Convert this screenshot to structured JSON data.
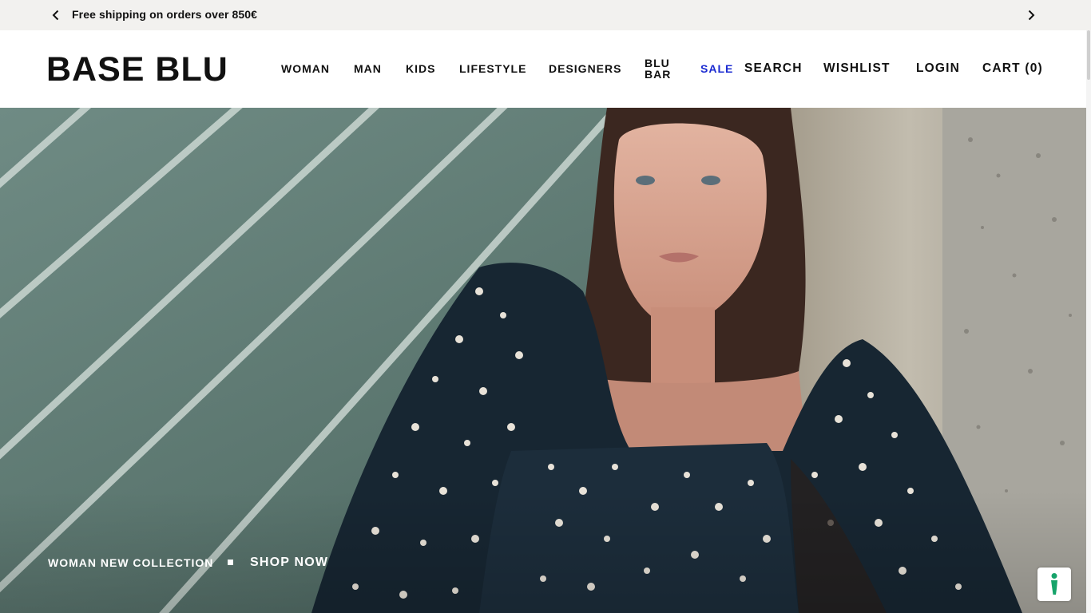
{
  "announcement": {
    "text": "Free shipping on orders over 850€",
    "prev_icon": "chevron-left-icon",
    "next_icon": "chevron-right-icon"
  },
  "header": {
    "logo": "BASE BLU",
    "nav": {
      "woman": "WOMAN",
      "man": "MAN",
      "kids": "KIDS",
      "lifestyle": "LIFESTYLE",
      "designers": "DESIGNERS",
      "blu_bar_1": "BLU",
      "blu_bar_2": "BAR",
      "sale": "SALE"
    },
    "utility": {
      "search": "SEARCH",
      "wishlist": "WISHLIST",
      "login": "LOGIN",
      "cart": "CART (0)"
    }
  },
  "hero": {
    "collection_label": "WOMAN NEW COLLECTION",
    "cta": "SHOP NOW"
  },
  "accessibility": {
    "icon": "accessibility-icon"
  },
  "colors": {
    "sale": "#1b2bd1",
    "announcement_bg": "#f2f1ef",
    "accessibility_icon": "#16a36a"
  }
}
